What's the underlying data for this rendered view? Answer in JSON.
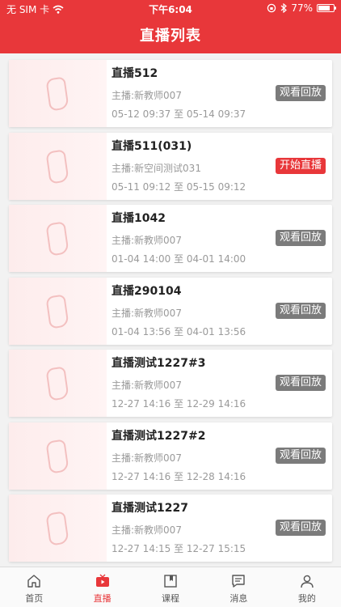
{
  "status_bar": {
    "carrier": "无 SIM 卡",
    "time": "下午6:04",
    "battery": "77%",
    "battery_level": 0.77
  },
  "header": {
    "title": "直播列表"
  },
  "items": [
    {
      "title": "直播512",
      "host": "主播:新教师007",
      "time": "05-12 09:37 至 05-14 09:37",
      "action": "观看回放",
      "action_type": "replay"
    },
    {
      "title": "直播511(031)",
      "host": "主播:新空间测试031",
      "time": "05-11 09:12 至 05-15 09:12",
      "action": "开始直播",
      "action_type": "start"
    },
    {
      "title": "直播1042",
      "host": "主播:新教师007",
      "time": "01-04 14:00 至 04-01 14:00",
      "action": "观看回放",
      "action_type": "replay"
    },
    {
      "title": "直播290104",
      "host": "主播:新教师007",
      "time": "01-04 13:56 至 04-01 13:56",
      "action": "观看回放",
      "action_type": "replay"
    },
    {
      "title": "直播测试1227#3",
      "host": "主播:新教师007",
      "time": "12-27 14:16 至 12-29 14:16",
      "action": "观看回放",
      "action_type": "replay"
    },
    {
      "title": "直播测试1227#2",
      "host": "主播:新教师007",
      "time": "12-27 14:16 至 12-28 14:16",
      "action": "观看回放",
      "action_type": "replay"
    },
    {
      "title": "直播测试1227",
      "host": "主播:新教师007",
      "time": "12-27 14:15 至 12-27 15:15",
      "action": "观看回放",
      "action_type": "replay"
    }
  ],
  "tabs": [
    {
      "label": "首页",
      "icon": "home-icon",
      "active": false
    },
    {
      "label": "直播",
      "icon": "live-tv-icon",
      "active": true
    },
    {
      "label": "课程",
      "icon": "book-icon",
      "active": false
    },
    {
      "label": "消息",
      "icon": "message-icon",
      "active": false
    },
    {
      "label": "我的",
      "icon": "user-icon",
      "active": false
    }
  ],
  "colors": {
    "brand_red": "#e8373a",
    "replay_gray": "#7b7b7b"
  }
}
